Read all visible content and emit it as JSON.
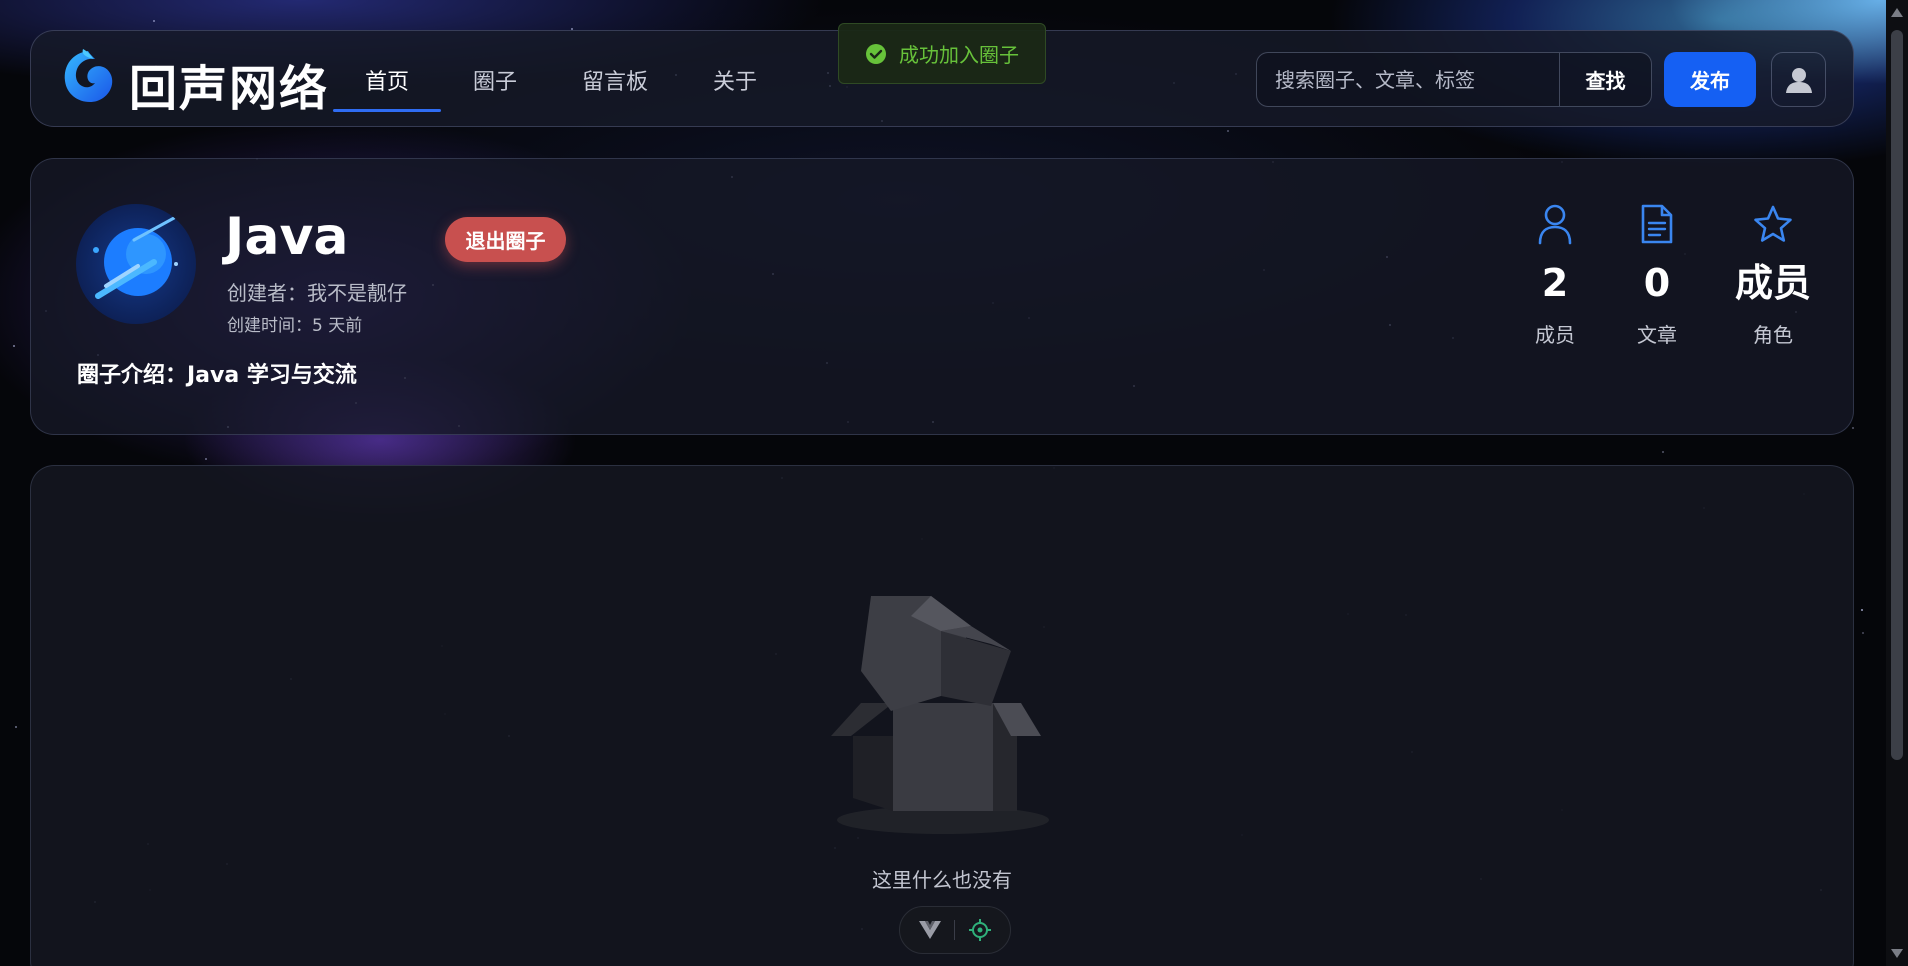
{
  "header": {
    "brand": "回声网络",
    "tabs": [
      {
        "label": "首页",
        "active": true
      },
      {
        "label": "圈子",
        "active": false
      },
      {
        "label": "留言板",
        "active": false
      },
      {
        "label": "关于",
        "active": false
      }
    ],
    "search": {
      "placeholder": "搜索圈子、文章、标签",
      "button_label": "查找"
    },
    "publish_label": "发布"
  },
  "toast": {
    "message": "成功加入圈子",
    "type": "success",
    "color": "#67c23a"
  },
  "circle": {
    "name": "Java",
    "leave_label": "退出圈子",
    "creator": "创建者：我不是靓仔",
    "created_time": "创建时间：5 天前",
    "intro": "圈子介绍：Java 学习与交流",
    "stats": [
      {
        "icon": "user-icon",
        "value": "2",
        "label": "成员"
      },
      {
        "icon": "document-icon",
        "value": "0",
        "label": "文章"
      },
      {
        "icon": "star-icon",
        "value": "成员",
        "label": "角色"
      }
    ]
  },
  "content": {
    "empty_text": "这里什么也没有"
  },
  "colors": {
    "accent": "#1560f3",
    "danger": "#c8504f",
    "icon_blue": "#3a86f0"
  }
}
